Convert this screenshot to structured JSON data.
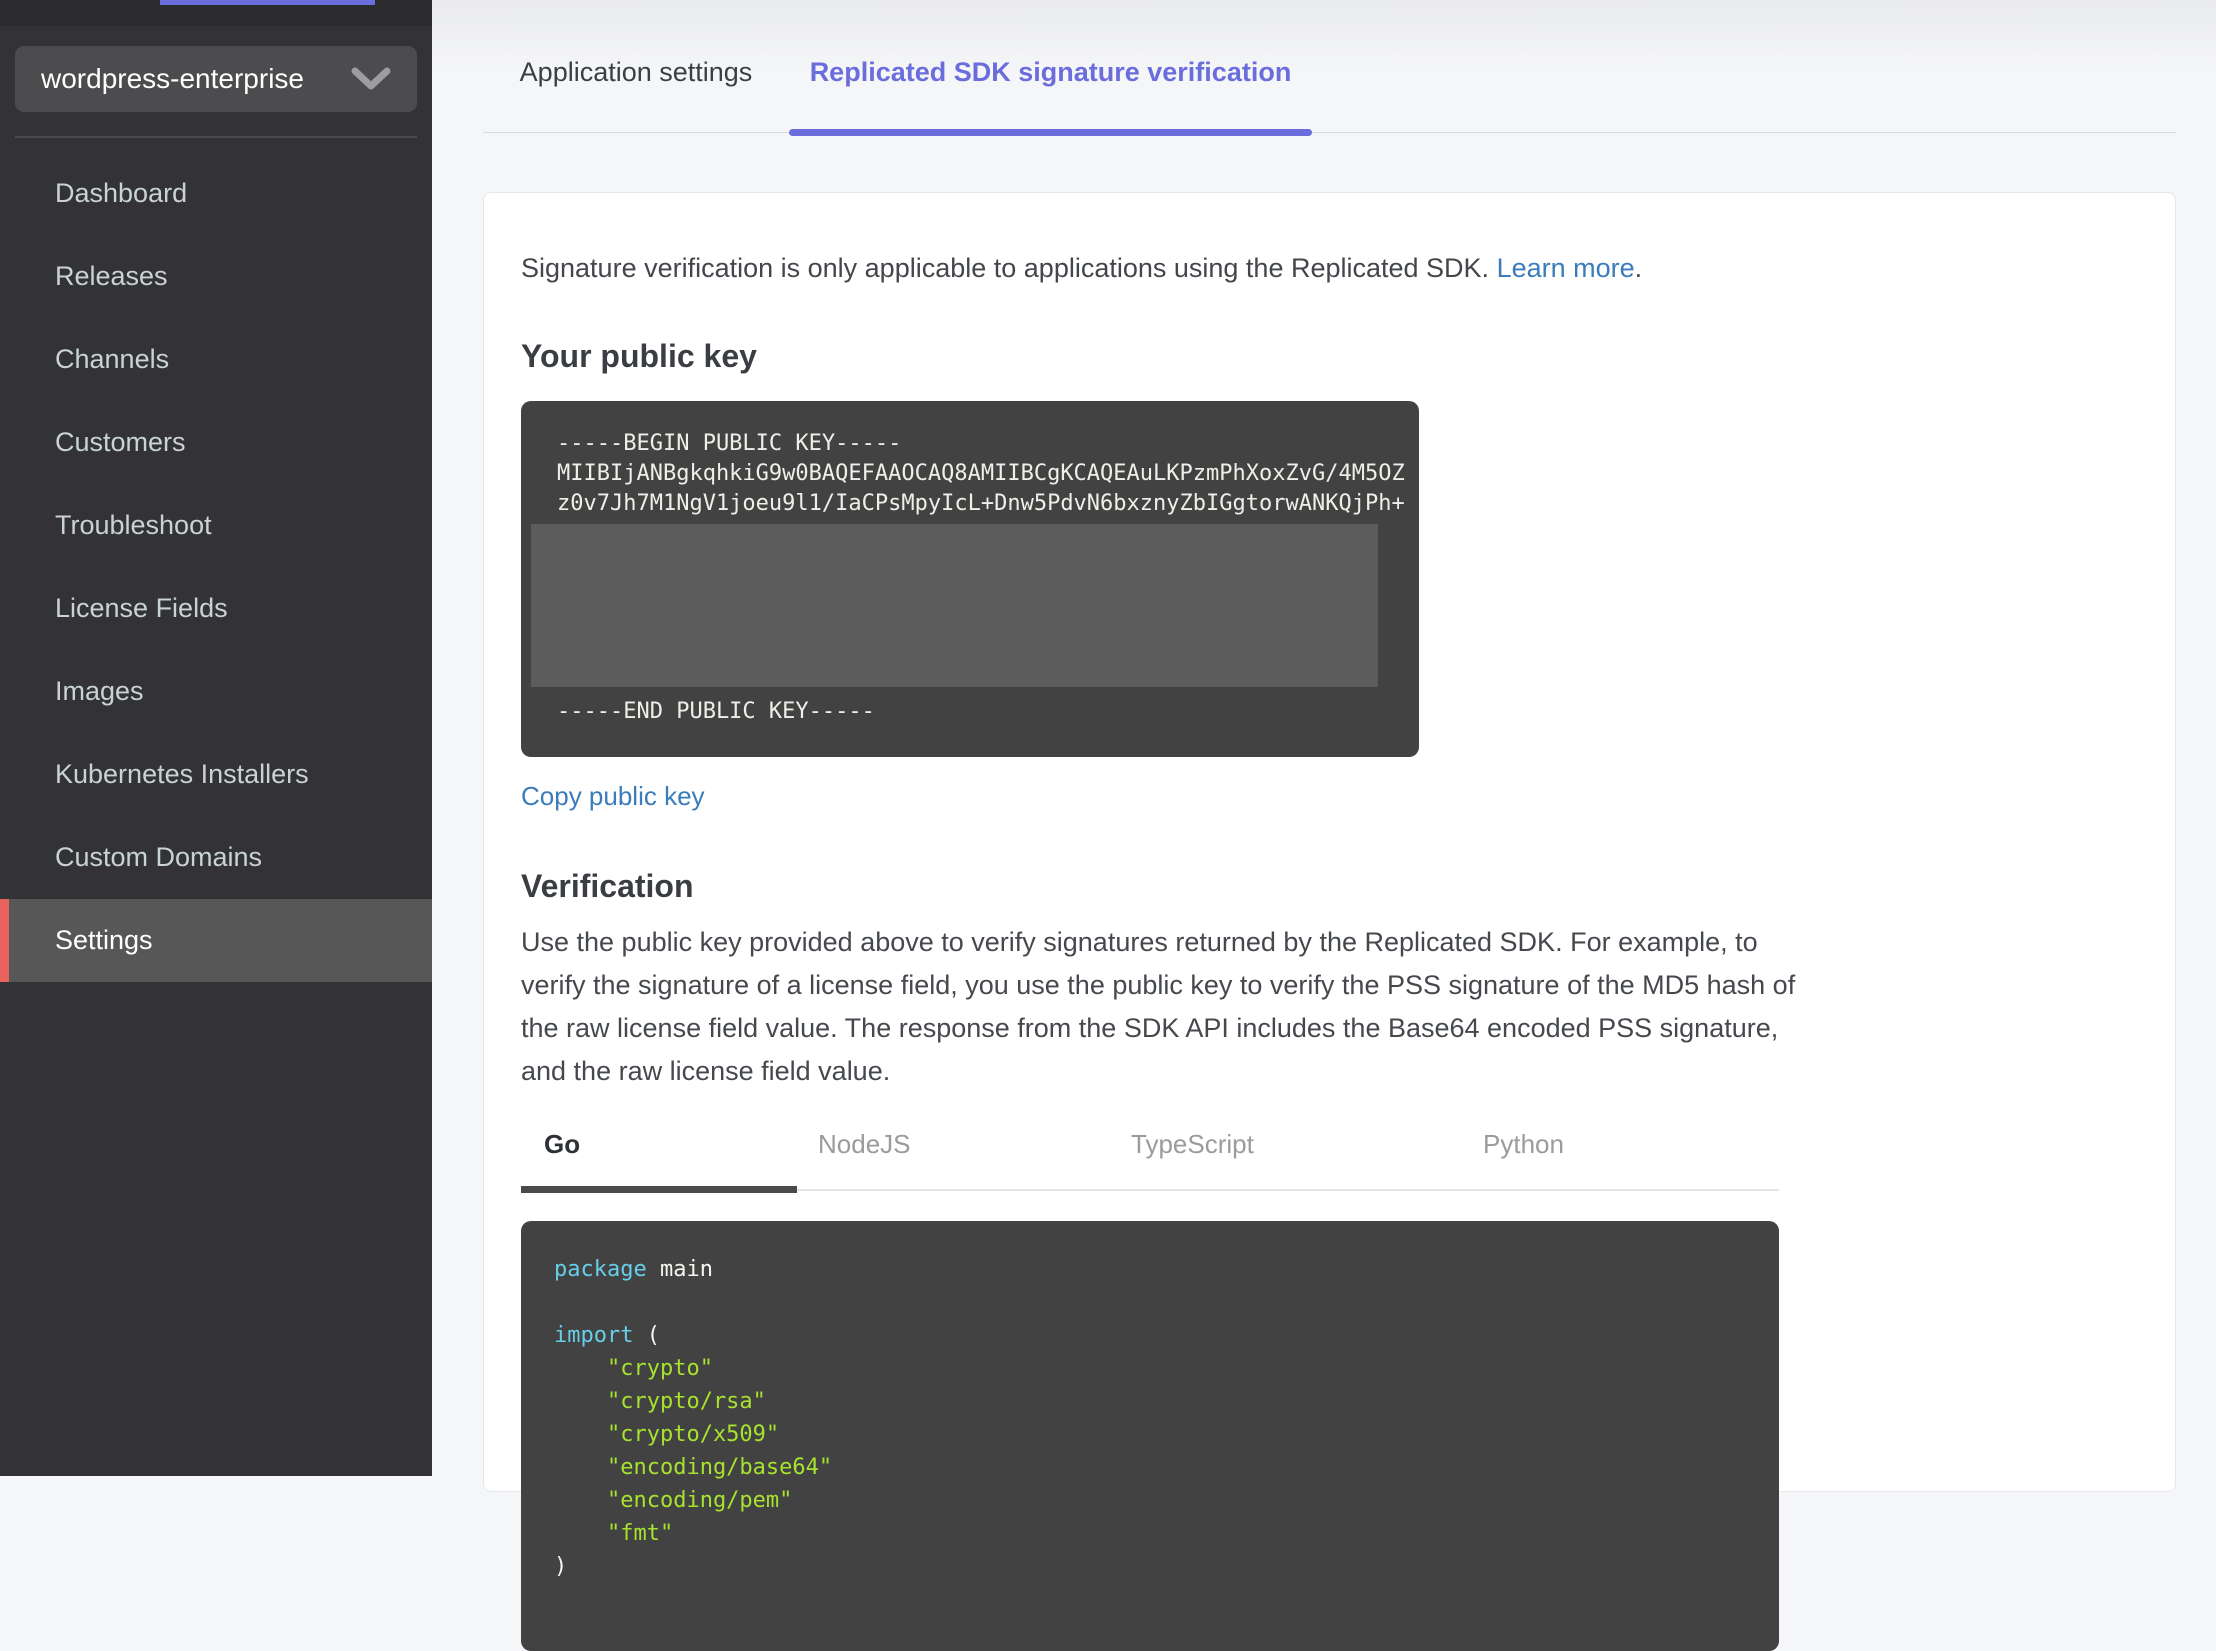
{
  "colors": {
    "accent_purple": "#6b6ddd",
    "accent_red": "#e8635c",
    "link_blue": "#3b7cba",
    "code_keyword": "#67cde8",
    "code_string": "#a6e22e",
    "code_bg": "#424242"
  },
  "sidebar": {
    "app_selector": {
      "label": "wordpress-enterprise"
    },
    "items": [
      {
        "label": "Dashboard",
        "active": false
      },
      {
        "label": "Releases",
        "active": false
      },
      {
        "label": "Channels",
        "active": false
      },
      {
        "label": "Customers",
        "active": false
      },
      {
        "label": "Troubleshoot",
        "active": false
      },
      {
        "label": "License Fields",
        "active": false
      },
      {
        "label": "Images",
        "active": false
      },
      {
        "label": "Kubernetes Installers",
        "active": false
      },
      {
        "label": "Custom Domains",
        "active": false
      },
      {
        "label": "Settings",
        "active": true
      }
    ]
  },
  "tabs": [
    {
      "label": "Application settings",
      "active": false
    },
    {
      "label": "Replicated SDK signature verification",
      "active": true
    }
  ],
  "main": {
    "intro": {
      "text": "Signature verification is only applicable to applications using the Replicated SDK. ",
      "link_label": "Learn more",
      "suffix": "."
    },
    "public_key_section": {
      "heading": "Your public key",
      "key_lines": {
        "begin": "-----BEGIN PUBLIC KEY-----",
        "line1": "MIIBIjANBgkqhkiG9w0BAQEFAAOCAQ8AMIIBCgKCAQEAuLKPzmPhXoxZvG/4M5OZ",
        "line2": "z0v7Jh7M1NgV1joeu9l1/IaCPsMpyIcL+Dnw5PdvN6bxznyZbIGgtorwANKQjPh+",
        "end": "-----END PUBLIC KEY-----"
      },
      "copy_link": "Copy public key"
    },
    "verification_section": {
      "heading": "Verification",
      "body": "Use the public key provided above to verify signatures returned by the Replicated SDK. For example, to verify the signature of a license field, you use the public key to verify the PSS signature of the MD5 hash of the raw license field value. The response from the SDK API includes the Base64 encoded PSS signature, and the raw license field value."
    },
    "code_tabs": [
      {
        "label": "Go",
        "active": true
      },
      {
        "label": "NodeJS",
        "active": false
      },
      {
        "label": "TypeScript",
        "active": false
      },
      {
        "label": "Python",
        "active": false
      }
    ],
    "code_block": {
      "package_kw": "package",
      "package_rest": " main",
      "import_kw": "import",
      "import_rest": " (",
      "imports": [
        "    \"crypto\"",
        "    \"crypto/rsa\"",
        "    \"crypto/x509\"",
        "    \"encoding/base64\"",
        "    \"encoding/pem\"",
        "    \"fmt\""
      ],
      "close": ")"
    }
  }
}
